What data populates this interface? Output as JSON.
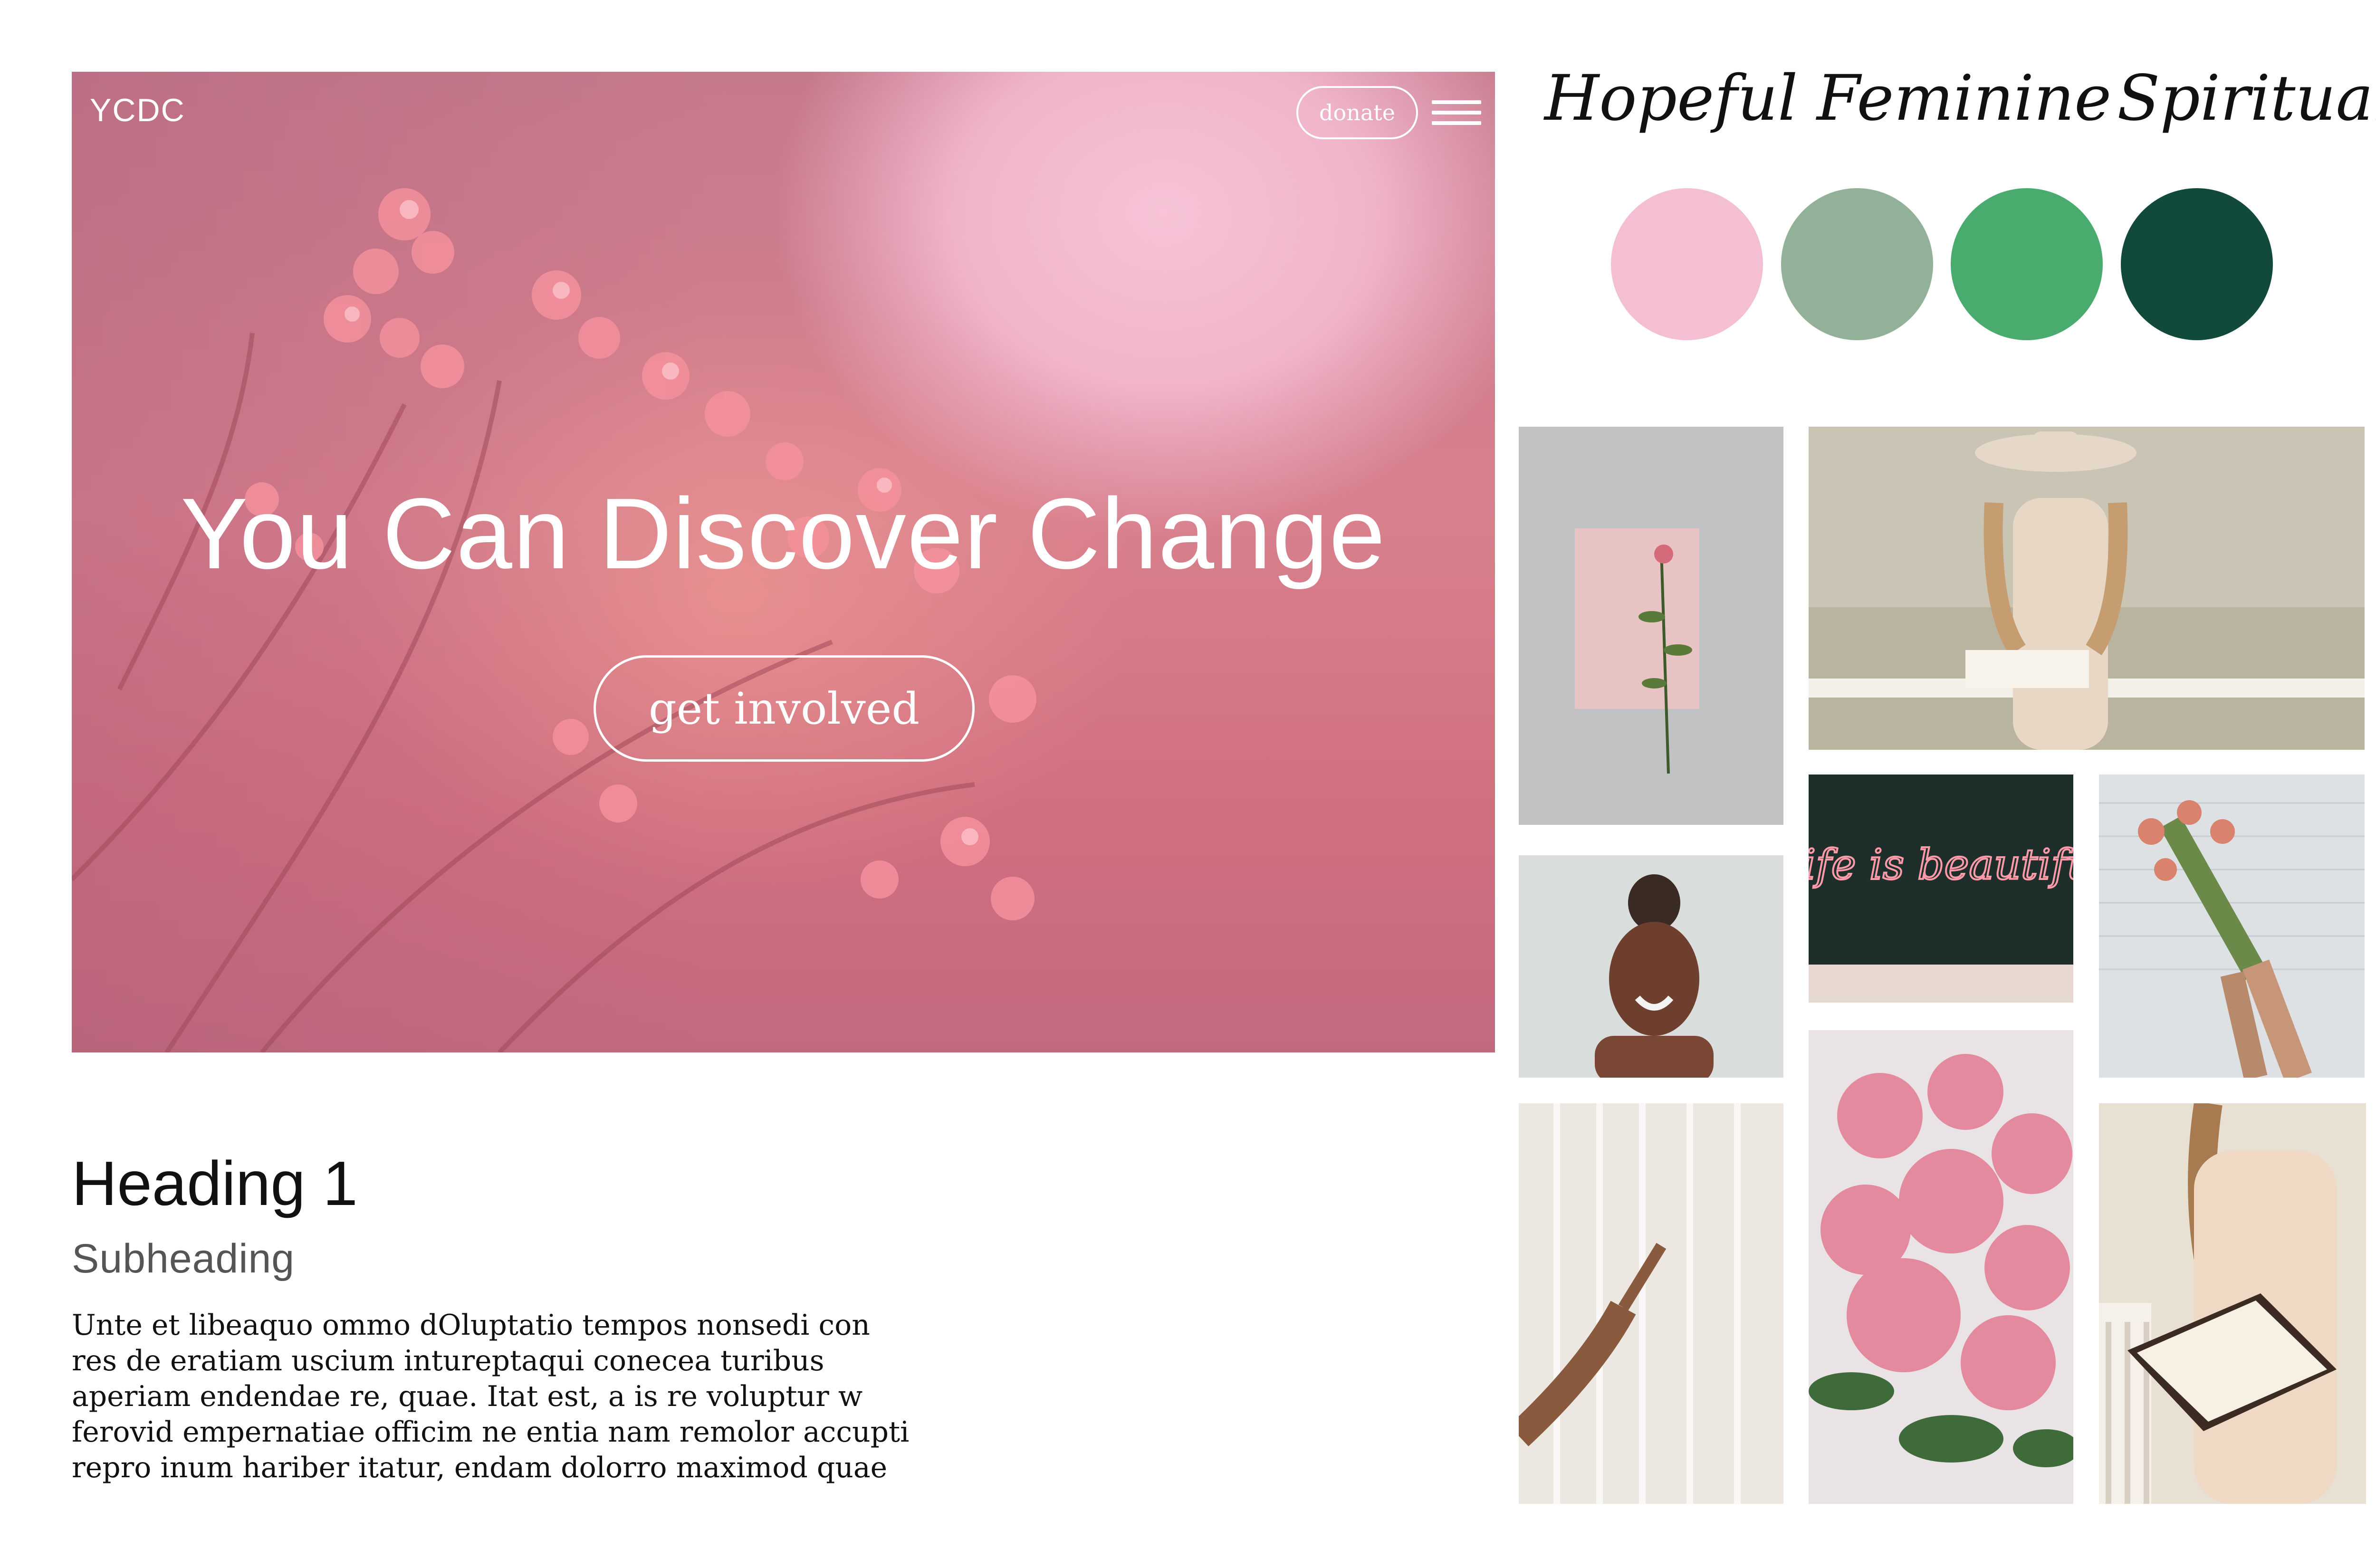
{
  "hero": {
    "logo": "YCDC",
    "donate_label": "donate",
    "title": "You Can Discover Change",
    "cta_label": "get involved"
  },
  "typography": {
    "heading": "Heading 1",
    "subheading": "Subheading",
    "body_lines": [
      "Unte et libeaquo ommo dOluptatio tempos nonsedi con",
      "res de eratiam uscium intureptaqui conecea turibus",
      "aperiam endendae re, quae. Itat est, a is re voluptur w",
      "ferovid empernatiae officim ne entia nam remolor accupti",
      "repro inum hariber itatur, endam dolorro maximod quae"
    ]
  },
  "mood_words": [
    "Hopeful",
    "Feminine",
    "Spiritual"
  ],
  "palette": [
    "#f4bfd3",
    "#93b199",
    "#4aab6f",
    "#114a3b"
  ],
  "photos": {
    "neon_sign_text": "Life is beautiful"
  },
  "icons": {
    "menu": "hamburger-menu-icon"
  }
}
